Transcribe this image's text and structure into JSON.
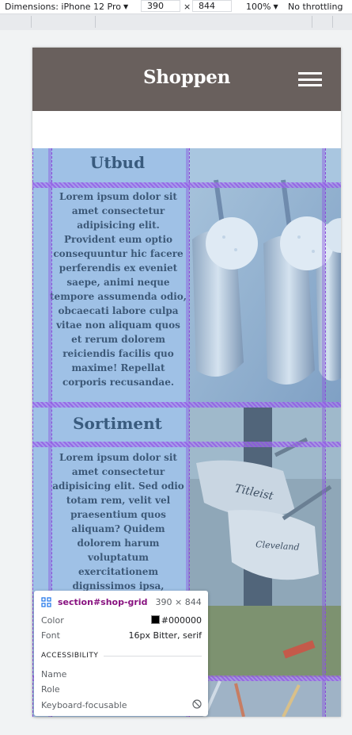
{
  "devtools": {
    "dimensions_label": "Dimensions: iPhone 12 Pro",
    "width_value": "390",
    "times": "×",
    "height_value": "844",
    "zoom": "100%",
    "throttling": "No throttling"
  },
  "site": {
    "brand": "Shoppen",
    "header_color": "#69605d"
  },
  "sections": [
    {
      "heading": "Utbud",
      "text": "Lorem ipsum dolor sit amet consectetur adipisicing elit. Provident eum optio consequuntur hic facere perferendis ex eveniet saepe, animi neque tempore assumenda odio, obcaecati labore culpa vitae non aliquam quos et rerum dolorem reiciendis facilis quo maxime! Repellat corporis recusandae."
    },
    {
      "heading": "Sortiment",
      "text": "Lorem ipsum dolor sit amet consectetur adipisicing elit. Sed odio totam rem, velit vel praesentium quos aliquam? Quidem dolorem harum voluptatum exercitationem dignissimos ipsa,"
    }
  ],
  "photo_brands": [
    "Titleist",
    "Cleveland"
  ],
  "inspector": {
    "selector_tag": "section",
    "selector_id": "#shop-grid",
    "size": "390 × 844",
    "color_label": "Color",
    "color_value": "#000000",
    "font_label": "Font",
    "font_value": "16px Bitter, serif",
    "accessibility_title": "ACCESSIBILITY",
    "name_label": "Name",
    "role_label": "Role",
    "focusable_label": "Keyboard-focusable",
    "grid_icon": "grid-icon",
    "not_focusable_icon": "blocked-icon"
  },
  "colors": {
    "highlight": "#9fc1e6",
    "grid_overlay": "#8a4dd9",
    "heading_text": "#395b7e"
  }
}
